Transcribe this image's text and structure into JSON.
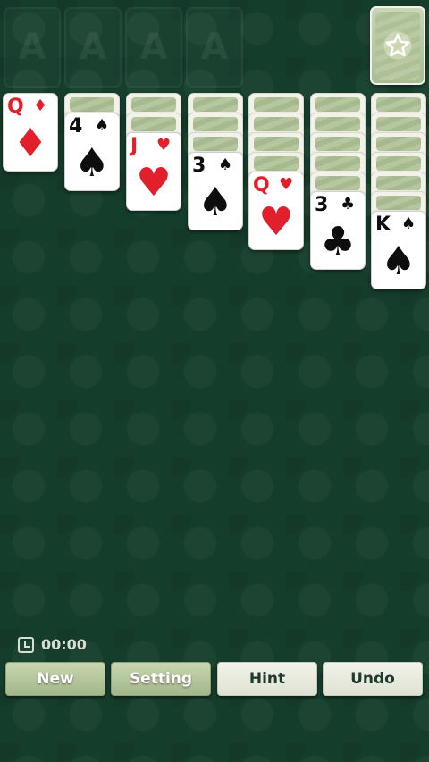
{
  "foundations": [
    {
      "label": "A"
    },
    {
      "label": "A"
    },
    {
      "label": "A"
    },
    {
      "label": "A"
    }
  ],
  "stock": {
    "icon": "star-icon"
  },
  "tableau": [
    {
      "backs": 0,
      "card": {
        "rank": "Q",
        "suit": "♦",
        "color": "red"
      }
    },
    {
      "backs": 1,
      "card": {
        "rank": "4",
        "suit": "♠",
        "color": "black"
      }
    },
    {
      "backs": 2,
      "card": {
        "rank": "J",
        "suit": "♥",
        "color": "red"
      }
    },
    {
      "backs": 3,
      "card": {
        "rank": "3",
        "suit": "♠",
        "color": "black"
      }
    },
    {
      "backs": 4,
      "card": {
        "rank": "Q",
        "suit": "♥",
        "color": "red"
      }
    },
    {
      "backs": 5,
      "card": {
        "rank": "3",
        "suit": "♣",
        "color": "black"
      }
    },
    {
      "backs": 6,
      "card": {
        "rank": "K",
        "suit": "♠",
        "color": "black"
      }
    }
  ],
  "timer": {
    "value": "00:00"
  },
  "buttons": {
    "new_label": "New",
    "setting_label": "Setting",
    "hint_label": "Hint",
    "undo_label": "Undo"
  },
  "colors": {
    "felt": "#153d2c",
    "red_suit": "#e2202c",
    "black_suit": "#0d0d0d"
  }
}
